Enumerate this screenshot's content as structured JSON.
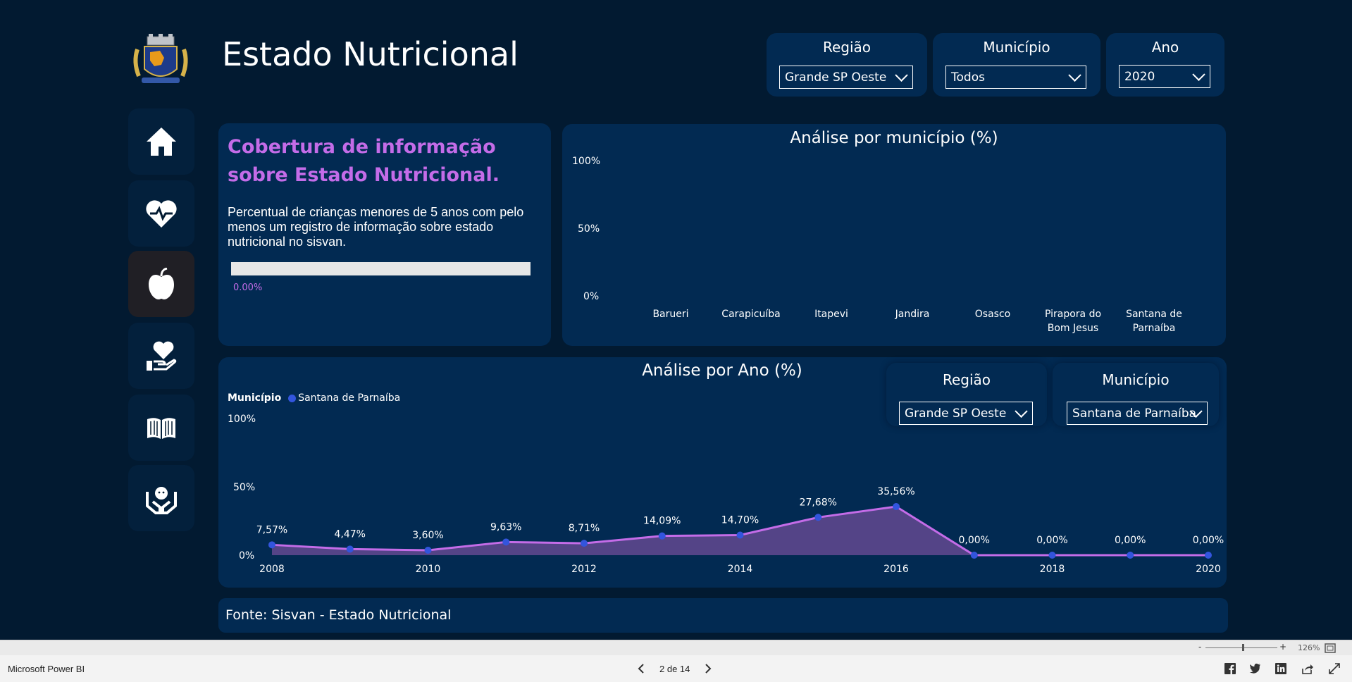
{
  "header": {
    "title": "Estado Nutricional"
  },
  "filters": [
    {
      "label": "Região",
      "value": "Grande SP Oeste"
    },
    {
      "label": "Município",
      "value": "Todos"
    },
    {
      "label": "Ano",
      "value": "2020"
    }
  ],
  "nav": [
    "home-icon",
    "heart-pulse-icon",
    "apple-icon",
    "hand-heart-icon",
    "book-icon",
    "hands-baby-icon"
  ],
  "coverage": {
    "title_line1": "Cobertura de informação",
    "title_line2": "sobre Estado Nutricional.",
    "description": "Percentual de crianças menores de 5 anos com pelo menos um registro de informação sobre estado nutricional no sisvan.",
    "progress": 0.0,
    "value_label": "0.00%",
    "accent": "#c46ce8"
  },
  "municipio_chart": {
    "title": "Análise por município (%)",
    "yticks": [
      "100%",
      "50%",
      "0%"
    ],
    "categories": [
      {
        "line1": "Barueri",
        "line2": ""
      },
      {
        "line1": "Carapicuíba",
        "line2": ""
      },
      {
        "line1": "Itapevi",
        "line2": ""
      },
      {
        "line1": "Jandira",
        "line2": ""
      },
      {
        "line1": "Osasco",
        "line2": ""
      },
      {
        "line1": "Pirapora do",
        "line2": "Bom Jesus"
      },
      {
        "line1": "Santana de",
        "line2": "Parnaíba"
      }
    ]
  },
  "ano_section": {
    "title": "Análise por Ano (%)",
    "legend_title": "Município",
    "legend_item": "Santana de Parnaíba",
    "filters": [
      {
        "label": "Região",
        "value": "Grande SP Oeste"
      },
      {
        "label": "Município",
        "value": "Santana de Parnaíba"
      }
    ],
    "yticks": [
      "100%",
      "50%",
      "0%"
    ],
    "xticks": [
      "2008",
      "2010",
      "2012",
      "2014",
      "2016",
      "2018",
      "2020"
    ]
  },
  "chart_data": {
    "type": "area",
    "title": "Análise por Ano (%)",
    "x": [
      2008,
      2009,
      2010,
      2011,
      2012,
      2013,
      2014,
      2015,
      2016,
      2017,
      2018,
      2019,
      2020
    ],
    "series": [
      {
        "name": "Santana de Parnaíba",
        "values": [
          7.57,
          4.47,
          3.6,
          9.63,
          8.71,
          14.09,
          14.7,
          27.68,
          35.56,
          0.0,
          0.0,
          0.0,
          0.0
        ],
        "labels": [
          "7,57%",
          "4,47%",
          "3,60%",
          "9,63%",
          "8,71%",
          "14,09%",
          "14,70%",
          "27,68%",
          "35,56%",
          "0,00%",
          "0,00%",
          "0,00%",
          "0,00%"
        ]
      }
    ],
    "ylim": [
      0,
      100
    ],
    "line_color": "#c46ce8",
    "fill_color": "#544487",
    "point_color": "#3355dd",
    "legend": "top-left"
  },
  "source": {
    "text": "Fonte:  Sisvan - Estado Nutricional"
  },
  "statusbar": {
    "zoom_minus": "-",
    "zoom_plus": "+",
    "zoom": "126%"
  },
  "footer": {
    "app": "Microsoft Power BI",
    "page": "2 de 14",
    "share_icons": [
      "facebook-icon",
      "twitter-icon",
      "linkedin-icon",
      "share-icon",
      "fullscreen-icon"
    ]
  }
}
